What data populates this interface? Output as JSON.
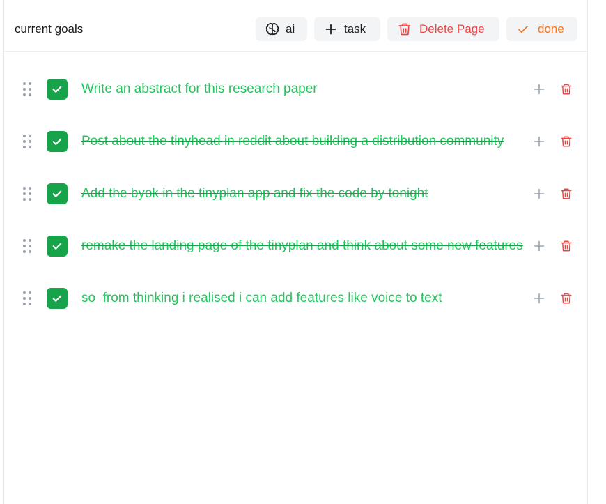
{
  "page": {
    "title": "current goals"
  },
  "toolbar": {
    "ai_label": "ai",
    "task_label": "task",
    "delete_label": "Delete Page",
    "done_label": "done"
  },
  "icons": {
    "ai": "brain-icon",
    "task": "plus-icon",
    "delete": "trash-icon",
    "done": "check-icon",
    "drag": "drag-handle-icon",
    "add_subtask": "plus-icon",
    "delete_task": "trash-icon"
  },
  "colors": {
    "done_green": "#16a34a",
    "done_text_green": "#22c55e",
    "danger_red": "#ef4444",
    "done_orange": "#f97316",
    "button_bg": "#f3f4f6"
  },
  "tasks": [
    {
      "text": "Write an abstract for this research paper",
      "completed": true
    },
    {
      "text": "Post about the tinyhead in reddit about building a distribution community",
      "completed": true
    },
    {
      "text": "Add the byok in the tinyplan app and fix the code by tonight",
      "completed": true
    },
    {
      "text": "remake the landing page of the tinyplan and think about some new features",
      "completed": true
    },
    {
      "text": "so  from thinking i realised i can add features like voice to text ",
      "completed": true
    }
  ]
}
